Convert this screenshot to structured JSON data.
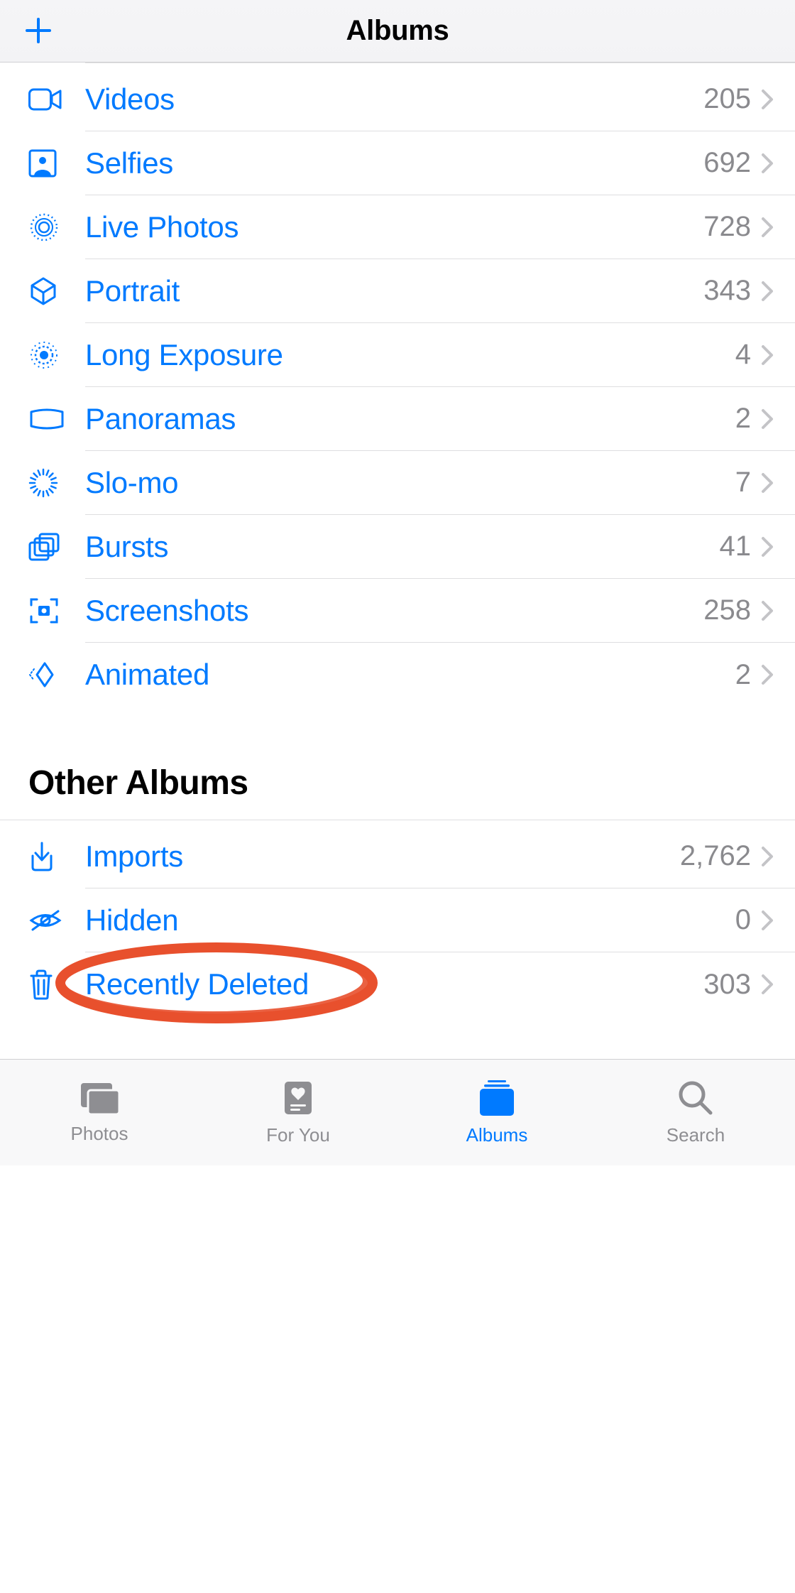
{
  "header": {
    "title": "Albums"
  },
  "media_types": [
    {
      "icon": "video-icon",
      "label": "Videos",
      "count": "205"
    },
    {
      "icon": "selfies-icon",
      "label": "Selfies",
      "count": "692"
    },
    {
      "icon": "live-photos-icon",
      "label": "Live Photos",
      "count": "728"
    },
    {
      "icon": "portrait-icon",
      "label": "Portrait",
      "count": "343"
    },
    {
      "icon": "long-exposure-icon",
      "label": "Long Exposure",
      "count": "4"
    },
    {
      "icon": "panoramas-icon",
      "label": "Panoramas",
      "count": "2"
    },
    {
      "icon": "slomo-icon",
      "label": "Slo-mo",
      "count": "7"
    },
    {
      "icon": "bursts-icon",
      "label": "Bursts",
      "count": "41"
    },
    {
      "icon": "screenshots-icon",
      "label": "Screenshots",
      "count": "258"
    },
    {
      "icon": "animated-icon",
      "label": "Animated",
      "count": "2"
    }
  ],
  "other_header": "Other Albums",
  "other_albums": [
    {
      "icon": "imports-icon",
      "label": "Imports",
      "count": "2,762"
    },
    {
      "icon": "hidden-icon",
      "label": "Hidden",
      "count": "0"
    },
    {
      "icon": "trash-icon",
      "label": "Recently Deleted",
      "count": "303",
      "annotated": true
    }
  ],
  "tabs": [
    {
      "icon": "photos-tab-icon",
      "label": "Photos",
      "active": false
    },
    {
      "icon": "foryou-tab-icon",
      "label": "For You",
      "active": false
    },
    {
      "icon": "albums-tab-icon",
      "label": "Albums",
      "active": true
    },
    {
      "icon": "search-tab-icon",
      "label": "Search",
      "active": false
    }
  ],
  "colors": {
    "accent": "#007aff",
    "secondary": "#8a8a8e",
    "annotation": "#e8502d"
  }
}
